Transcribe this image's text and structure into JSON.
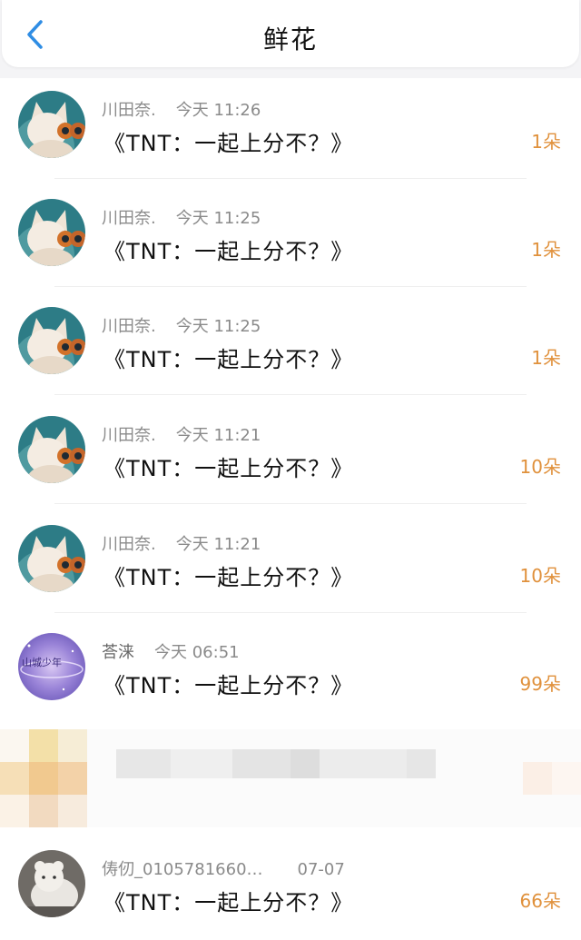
{
  "header": {
    "title": "鲜花",
    "back_icon": "chevron-left-icon",
    "accent": "#2f8de4"
  },
  "items": [
    {
      "name": "川田奈.",
      "time": "今天 11:26",
      "message": "《TNT：一起上分不？》",
      "count": "1朵",
      "avatar": "cat-binoculars"
    },
    {
      "name": "川田奈.",
      "time": "今天 11:25",
      "message": "《TNT：一起上分不？》",
      "count": "1朵",
      "avatar": "cat-binoculars"
    },
    {
      "name": "川田奈.",
      "time": "今天 11:25",
      "message": "《TNT：一起上分不？》",
      "count": "1朵",
      "avatar": "cat-binoculars"
    },
    {
      "name": "川田奈.",
      "time": "今天 11:21",
      "message": "《TNT：一起上分不？》",
      "count": "10朵",
      "avatar": "cat-binoculars"
    },
    {
      "name": "川田奈.",
      "time": "今天 11:21",
      "message": "《TNT：一起上分不？》",
      "count": "10朵",
      "avatar": "cat-binoculars"
    },
    {
      "name": "荅涞",
      "time": "今天 06:51",
      "message": "《TNT：一起上分不？》",
      "count": "99朵",
      "avatar": "purple-galaxy",
      "avatar_text": "山城少年"
    },
    {
      "name": "",
      "time": "",
      "message": "",
      "count": "",
      "avatar": "blurred"
    },
    {
      "name": "俦仞_0105781660…",
      "time": "07-07",
      "message": "《TNT：一起上分不？》",
      "count": "66朵",
      "avatar": "white-plush"
    }
  ],
  "colors": {
    "count": "#e0913c",
    "meta": "#8a8a8a"
  }
}
